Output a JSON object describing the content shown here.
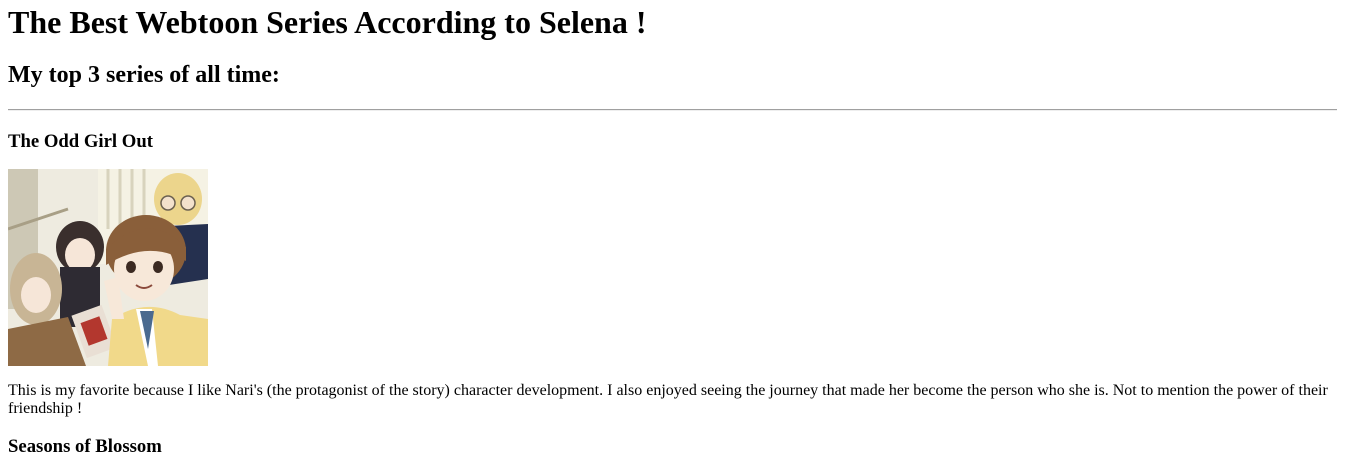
{
  "page": {
    "title": "The Best Webtoon Series According to Selena !",
    "subtitle": "My top 3 series of all time:"
  },
  "series": [
    {
      "name": "The Odd Girl Out",
      "description": "This is my favorite because I like Nari's (the protagonist of the story) character development. I also enjoyed seeing the journey that made her become the person who she is. Not to mention the power of their friendship !"
    },
    {
      "name": "Seasons of Blossom"
    }
  ]
}
